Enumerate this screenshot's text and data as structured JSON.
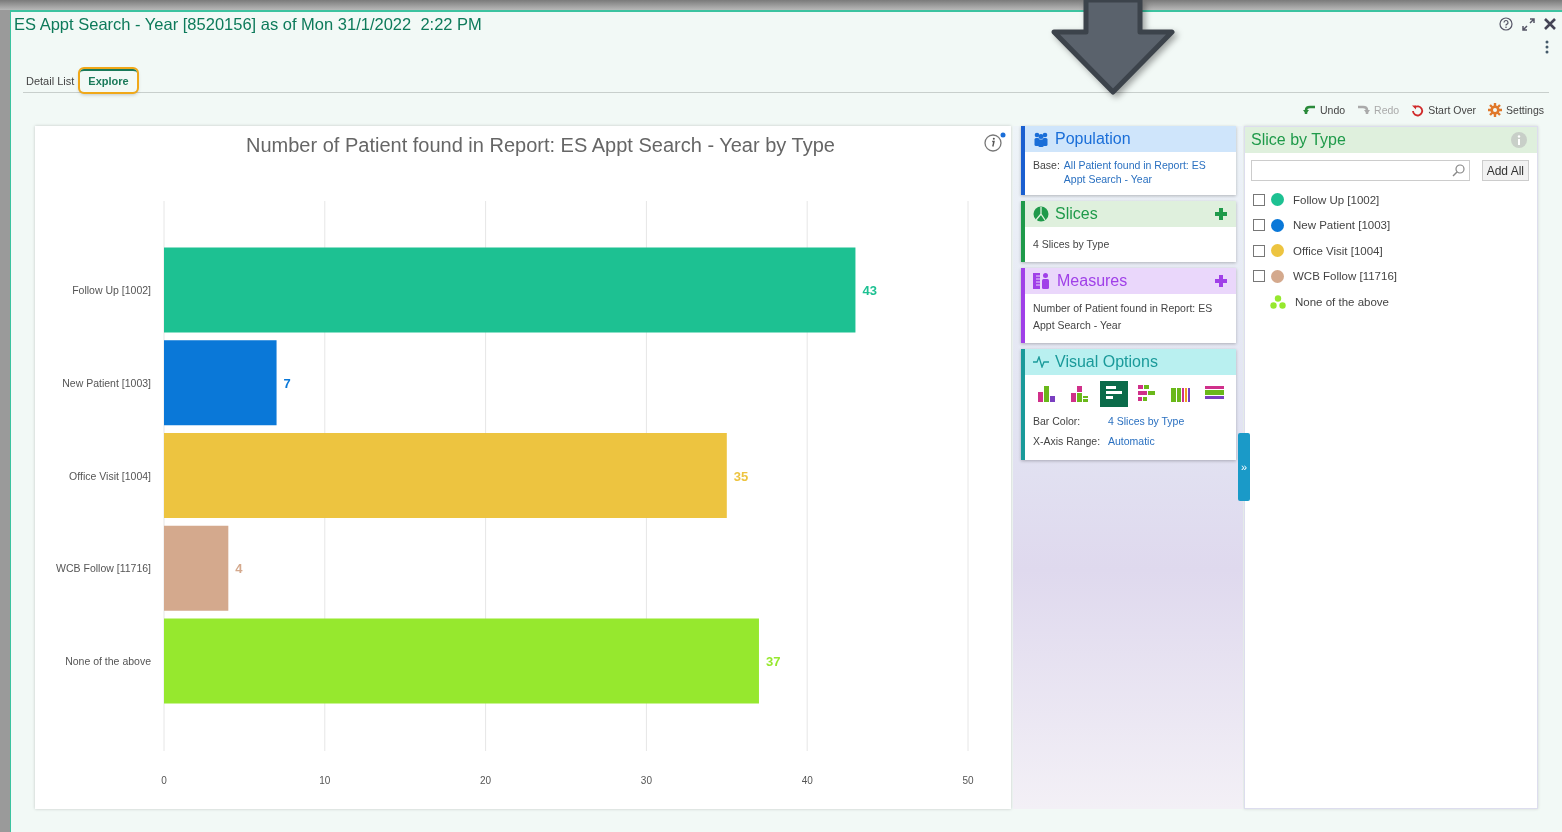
{
  "window": {
    "title": "ES Appt Search - Year [8520156] as of Mon 31/1/2022  2:22 PM"
  },
  "tabs": [
    {
      "label": "Detail List",
      "selected": false,
      "highlighted": false
    },
    {
      "label": "Explore",
      "selected": true,
      "highlighted": true
    }
  ],
  "toolbar": [
    {
      "kind": "undo",
      "label": "Undo",
      "disabled": false
    },
    {
      "kind": "redo",
      "label": "Redo",
      "disabled": true
    },
    {
      "kind": "start_over",
      "label": "Start Over",
      "disabled": false
    },
    {
      "kind": "settings",
      "label": "Settings",
      "disabled": false
    }
  ],
  "chart": {
    "chart_data": {
      "type": "bar",
      "orientation": "horizontal",
      "title": "Number of Patient found in Report: ES Appt Search - Year by Type",
      "categories": [
        "Follow Up [1002]",
        "New Patient [1003]",
        "Office Visit [1004]",
        "WCB Follow [11716]",
        "None of the above"
      ],
      "values": [
        43,
        7,
        35,
        4,
        37
      ],
      "xlim": [
        0,
        50
      ],
      "xticks": [
        0,
        10,
        20,
        30,
        40,
        50
      ],
      "data_labels": true,
      "grid": true
    }
  },
  "panels": {
    "population": {
      "title": "Population",
      "base_label": "Base:",
      "base_value": "All Patient found in Report: ES Appt Search - Year"
    },
    "slices": {
      "title": "Slices",
      "text": "4 Slices by Type"
    },
    "measures": {
      "title": "Measures",
      "text": "Number of Patient found in Report: ES Appt Search - Year"
    },
    "visual_options": {
      "title": "Visual Options",
      "chart_types": [
        {
          "kind": "columns",
          "selected": false
        },
        {
          "kind": "stacked_columns",
          "selected": false
        },
        {
          "kind": "bars",
          "selected": true
        },
        {
          "kind": "stacked_bars",
          "selected": false
        },
        {
          "kind": "full_columns",
          "selected": false
        },
        {
          "kind": "full_bars",
          "selected": false
        }
      ],
      "bar_color_label": "Bar Color:",
      "bar_color_value": "4 Slices by Type",
      "x_range_label": "X-Axis Range:",
      "x_range_value": "Automatic"
    }
  },
  "collapse_handle": {
    "label": "»"
  },
  "slice_by": {
    "title": "Slice by Type",
    "add_all": "Add All",
    "items": [
      {
        "kind": "checkbox",
        "label": "Follow Up [1002]",
        "checked": false,
        "color": "#1dc192"
      },
      {
        "kind": "checkbox",
        "label": "New Patient [1003]",
        "checked": false,
        "color": "#0a78d8"
      },
      {
        "kind": "checkbox",
        "label": "Office Visit [1004]",
        "checked": false,
        "color": "#edc440"
      },
      {
        "kind": "checkbox",
        "label": "WCB Follow [11716]",
        "checked": false,
        "color": "#d4a98d"
      },
      {
        "kind": "none",
        "label": "None of the above",
        "color": "#96e82e"
      }
    ]
  }
}
